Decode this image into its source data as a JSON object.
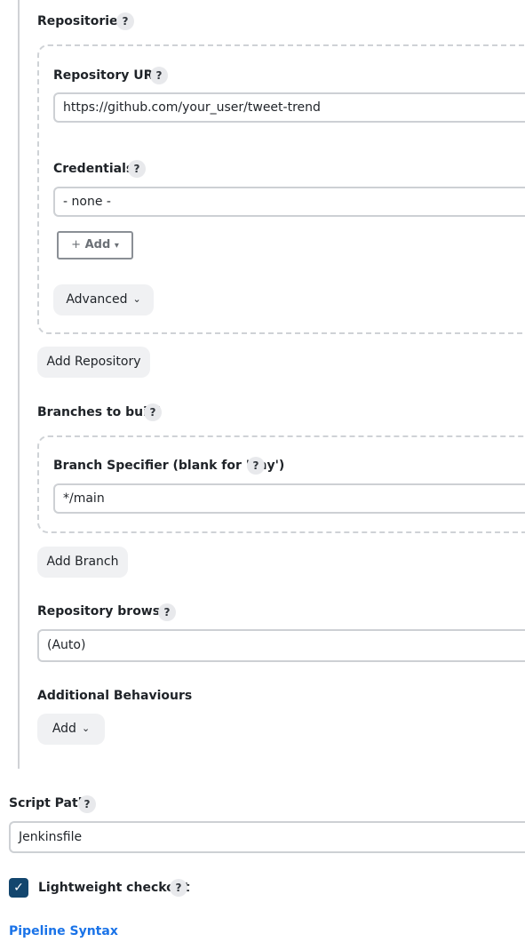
{
  "repositories": {
    "label": "Repositories",
    "help": "?",
    "repository_url": {
      "label": "Repository URL",
      "help": "?",
      "value": "https://github.com/your_user/tweet-trend"
    },
    "credentials": {
      "label": "Credentials",
      "help": "?",
      "selected": "- none -",
      "add_label": "Add",
      "add_plus": "+",
      "add_caret": "▾"
    },
    "advanced_label": "Advanced",
    "advanced_icon": "⌄",
    "add_repository_label": "Add Repository"
  },
  "branches": {
    "label": "Branches to build",
    "help": "?",
    "specifier_label": "Branch Specifier (blank for 'any')",
    "specifier_help": "?",
    "specifier_value": "*/main",
    "add_branch_label": "Add Branch"
  },
  "repository_browser": {
    "label": "Repository browser",
    "help": "?",
    "selected": "(Auto)"
  },
  "additional_behaviours": {
    "label": "Additional Behaviours",
    "add_label": "Add",
    "add_icon": "⌄"
  },
  "script_path": {
    "label": "Script Path",
    "help": "?",
    "value": "Jenkinsfile"
  },
  "lightweight_checkout": {
    "label": "Lightweight checkout",
    "help": "?",
    "checked": true,
    "check_glyph": "✓"
  },
  "pipeline_syntax_link": "Pipeline Syntax",
  "colors": {
    "checkbox": "#13466e",
    "link": "#1a73e8",
    "button_bg": "#f0f1f3"
  }
}
